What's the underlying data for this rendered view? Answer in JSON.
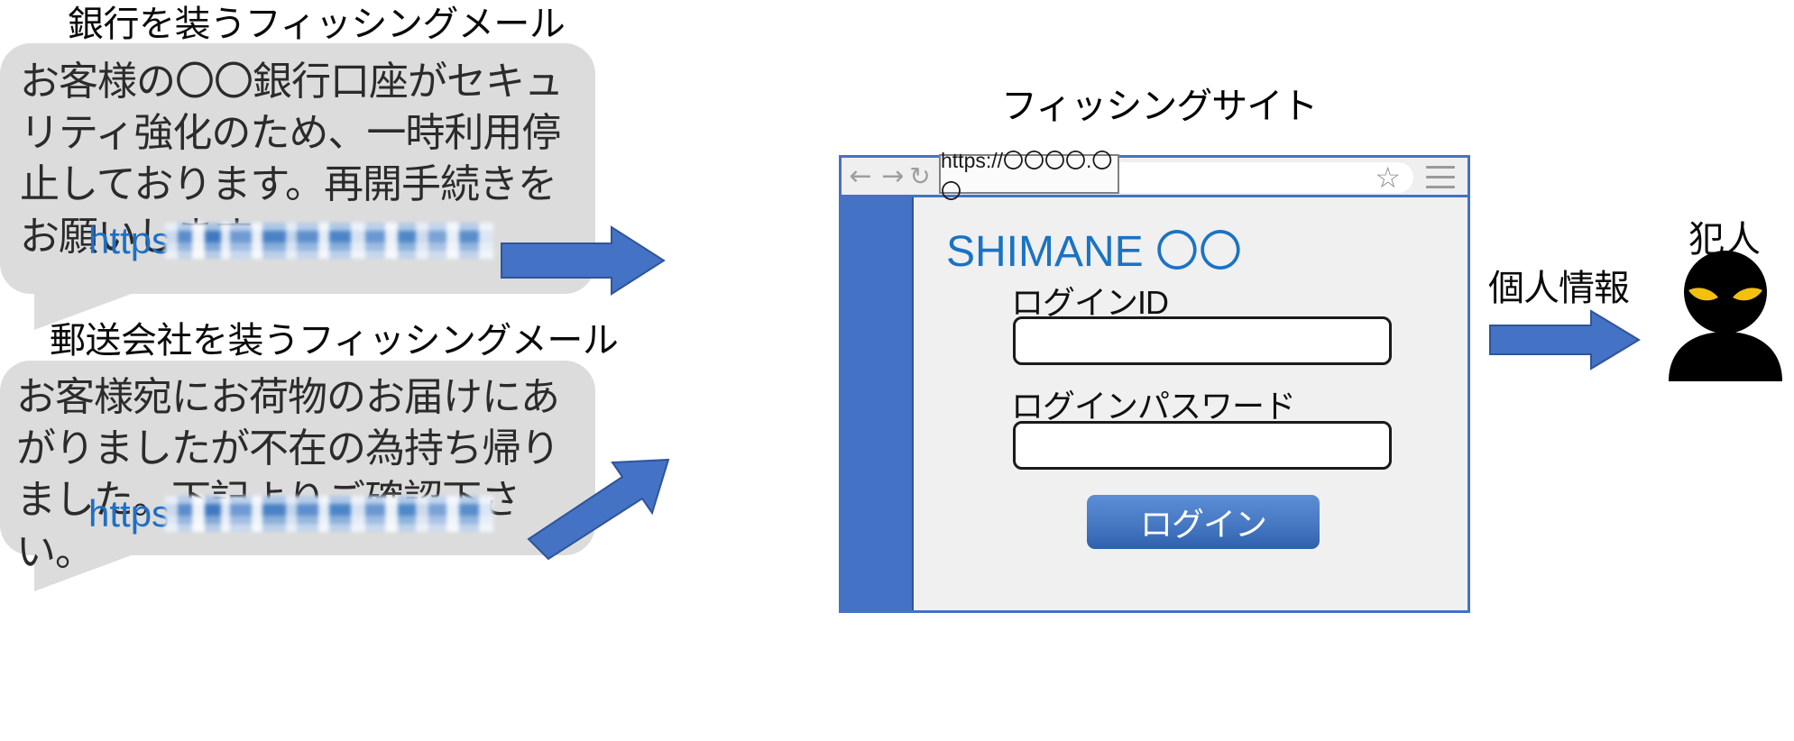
{
  "diagram": {
    "bubbles": [
      {
        "heading": "銀行を装うフィッシングメール",
        "text": "お客様の〇〇銀行口座がセキュリティ強化のため、一時利用停止しております。再開手続きをお願いします。",
        "link_prefix": "https",
        "link_masked": true
      },
      {
        "heading": "郵送会社を装うフィッシングメール",
        "text": "お客様宛にお荷物のお届けにあがりましたが不在の為持ち帰りました。下記よりご確認下さい。",
        "link_prefix": "https",
        "link_masked": true
      }
    ],
    "site_title": "フィッシングサイト",
    "flow_label": "個人情報",
    "criminal_label": "犯人"
  },
  "browser": {
    "back_icon": "←",
    "forward_icon": "→",
    "reload_icon": "↻",
    "url": "https://〇〇〇〇.〇〇",
    "bookmark_icon": "☆",
    "menu_icon": "≡"
  },
  "site": {
    "logo": "SHIMANE 〇〇",
    "login_id_label": "ログインID",
    "login_id_value": "",
    "login_id_placeholder": "",
    "password_label": "ログインパスワード",
    "password_value": "",
    "password_placeholder": "",
    "login_button": "ログイン"
  },
  "colors": {
    "accent_blue": "#4472c4",
    "logo_blue": "#1a73c4",
    "bubble_gray": "#dcdcdc",
    "link_blue": "#1f6fc4",
    "eye_yellow": "#f2c10d"
  }
}
